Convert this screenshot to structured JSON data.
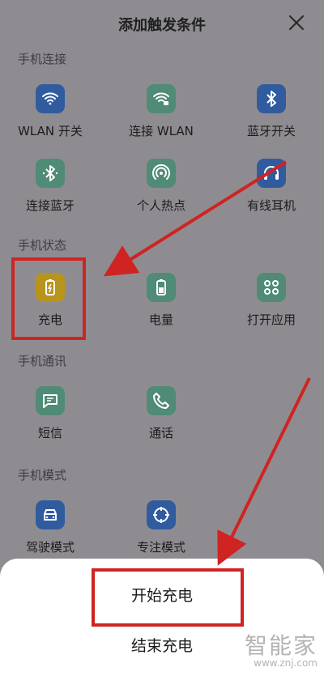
{
  "header": {
    "title": "添加触发条件",
    "close_icon": "close-icon"
  },
  "sections": [
    {
      "label": "手机连接",
      "items": [
        {
          "label": "WLAN 开关",
          "icon": "wifi-icon",
          "color": "blue"
        },
        {
          "label": "连接 WLAN",
          "icon": "wifi-lock-icon",
          "color": "green"
        },
        {
          "label": "蓝牙开关",
          "icon": "bluetooth-icon",
          "color": "blue"
        },
        {
          "label": "连接蓝牙",
          "icon": "bluetooth-connected-icon",
          "color": "green"
        },
        {
          "label": "个人热点",
          "icon": "hotspot-icon",
          "color": "green"
        },
        {
          "label": "有线耳机",
          "icon": "headset-icon",
          "color": "blue"
        }
      ]
    },
    {
      "label": "手机状态",
      "items": [
        {
          "label": "充电",
          "icon": "charging-battery-icon",
          "color": "yellow"
        },
        {
          "label": "电量",
          "icon": "battery-icon",
          "color": "green"
        },
        {
          "label": "打开应用",
          "icon": "app-grid-icon",
          "color": "green"
        }
      ]
    },
    {
      "label": "手机通讯",
      "items": [
        {
          "label": "短信",
          "icon": "message-icon",
          "color": "green"
        },
        {
          "label": "通话",
          "icon": "phone-icon",
          "color": "green"
        }
      ]
    },
    {
      "label": "手机模式",
      "items": [
        {
          "label": "驾驶模式",
          "icon": "car-icon",
          "color": "blue"
        },
        {
          "label": "专注模式",
          "icon": "focus-icon",
          "color": "blue"
        }
      ]
    }
  ],
  "sheet": {
    "options": [
      "开始充电",
      "结束充电"
    ]
  },
  "watermark": {
    "main": "智能家",
    "sub": "www.znj.com"
  }
}
